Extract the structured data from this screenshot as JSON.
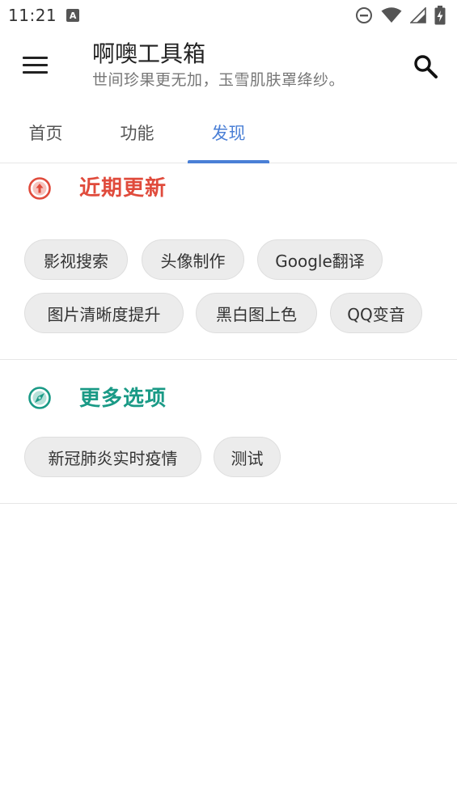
{
  "status_bar": {
    "time": "11:21",
    "notification_badge": "A"
  },
  "app_bar": {
    "title": "啊噢工具箱",
    "subtitle": "世间珍果更无加，玉雪肌肤罩绛纱。"
  },
  "tabs": [
    {
      "label": "首页"
    },
    {
      "label": "功能"
    },
    {
      "label": "发现",
      "active": true
    }
  ],
  "sections": [
    {
      "title": "近期更新",
      "icon": "arrow-up-circle-icon",
      "color": "#e04b3c",
      "chips": [
        "影视搜索",
        "头像制作",
        "Google翻译",
        "图片清晰度提升",
        "黑白图上色",
        "QQ变音"
      ]
    },
    {
      "title": "更多选项",
      "icon": "compass-icon",
      "color": "#1a9a86",
      "chips": [
        "新冠肺炎实时疫情",
        "测试"
      ]
    }
  ],
  "colors": {
    "accent": "#4a7fd6",
    "chip_bg": "#ececec"
  }
}
